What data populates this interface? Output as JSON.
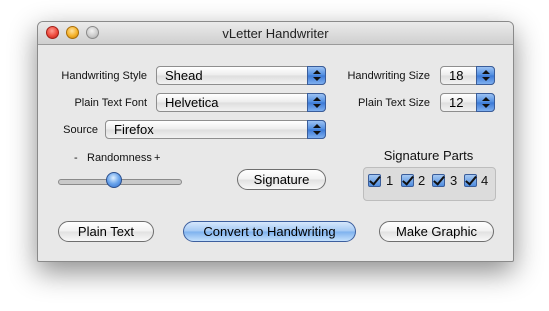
{
  "window": {
    "title": "vLetter Handwriter"
  },
  "fields": {
    "handwriting_style": {
      "label": "Handwriting Style",
      "value": "Shead"
    },
    "plain_text_font": {
      "label": "Plain Text Font",
      "value": "Helvetica"
    },
    "source": {
      "label": "Source",
      "value": "Firefox"
    },
    "handwriting_size": {
      "label": "Handwriting Size",
      "value": "18"
    },
    "plain_text_size": {
      "label": "Plain Text Size",
      "value": "12"
    }
  },
  "randomness": {
    "minus": "-",
    "label": "Randomness",
    "plus": "+",
    "level": 0.45
  },
  "signature_button": "Signature",
  "signature_parts": {
    "title": "Signature Parts",
    "items": [
      {
        "label": "1",
        "checked": true
      },
      {
        "label": "2",
        "checked": true
      },
      {
        "label": "3",
        "checked": true
      },
      {
        "label": "4",
        "checked": true
      }
    ]
  },
  "buttons": {
    "plain_text": "Plain Text",
    "convert": "Convert to Handwriting",
    "make_graphic": "Make Graphic"
  },
  "colors": {
    "accent": "#4d8be0",
    "close": "#ee4a3d",
    "minimize": "#f5b229"
  }
}
